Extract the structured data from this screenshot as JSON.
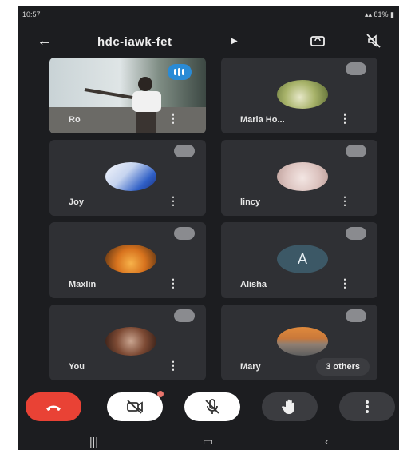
{
  "status_bar": {
    "time": "10:57",
    "battery": "81%"
  },
  "header": {
    "meeting_code": "hdc-iawk-fet"
  },
  "participants": [
    {
      "name": "Ro",
      "muted": false,
      "speaking": true
    },
    {
      "name": "Maria Ho...",
      "muted": true
    },
    {
      "name": "Joy",
      "muted": true
    },
    {
      "name": "lincy",
      "muted": true
    },
    {
      "name": "Maxlin",
      "muted": true
    },
    {
      "name": "Alisha",
      "muted": true,
      "avatar_letter": "A"
    },
    {
      "name": "You",
      "muted": true
    },
    {
      "name": "Mary",
      "muted": true
    }
  ],
  "overflow": {
    "label": "3 others"
  },
  "controls": {
    "end_call_color": "#e94235",
    "camera_badge_color": "#e8756d"
  },
  "colors": {
    "background": "#1c1d20",
    "tile": "#2f3034",
    "speaking": "#2a8bd6"
  }
}
